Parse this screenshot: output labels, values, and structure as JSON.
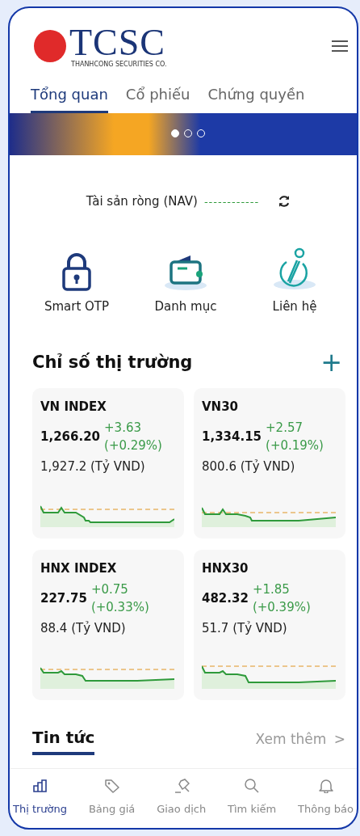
{
  "logo": {
    "name": "TCSC",
    "tagline": "THANHCONG SECURITIES CO."
  },
  "tabs": [
    {
      "label": "Tổng quan",
      "selected": true
    },
    {
      "label": "Cổ phiếu",
      "selected": false
    },
    {
      "label": "Chứng quyền",
      "selected": false
    }
  ],
  "banner": {
    "dots": [
      {
        "selected": true
      },
      {
        "selected": false
      },
      {
        "selected": false
      }
    ]
  },
  "nav": {
    "label": "Tài sản ròng (NAV)",
    "value": "------------"
  },
  "quick_actions": [
    {
      "kind": "lock",
      "label": "Smart OTP"
    },
    {
      "kind": "wallet",
      "label": "Danh mục"
    },
    {
      "kind": "info",
      "label": "Liên hệ"
    }
  ],
  "market": {
    "title": "Chỉ số thị trường",
    "add": "+",
    "indices": [
      {
        "name": "VN INDEX",
        "value": "1,266.20",
        "change": "+3.63",
        "percent": "(+0.29%)",
        "volume": "1,927.2 (Tỷ VND)"
      },
      {
        "name": "VN30",
        "value": "1,334.15",
        "change": "+2.57",
        "percent": "(+0.19%)",
        "volume": "800.6 (Tỷ VND)"
      },
      {
        "name": "HNX INDEX",
        "value": "227.75",
        "change": "+0.75",
        "percent": "(+0.33%)",
        "volume": "88.4 (Tỷ VND)"
      },
      {
        "name": "HNX30",
        "value": "482.32",
        "change": "+1.85",
        "percent": "(+0.39%)",
        "volume": "51.7 (Tỷ VND)"
      }
    ]
  },
  "news": {
    "title": "Tin tức",
    "more": "Xem thêm",
    "more_arrow": ">"
  },
  "bottom_nav": [
    {
      "kind": "chart",
      "label": "Thị trường",
      "selected": true
    },
    {
      "kind": "tag",
      "label": "Bảng giá",
      "selected": false
    },
    {
      "kind": "pen",
      "label": "Giao dịch",
      "selected": false
    },
    {
      "kind": "search",
      "label": "Tìm kiếm",
      "selected": false
    },
    {
      "kind": "bell",
      "label": "Thông báo",
      "selected": false
    }
  ]
}
